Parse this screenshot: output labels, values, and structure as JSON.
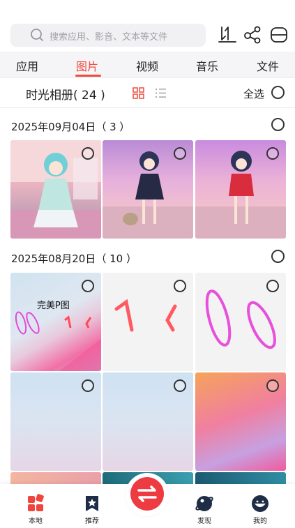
{
  "search": {
    "placeholder": "搜索应用、影音、文本等文件",
    "icon": "search-icon"
  },
  "toolbar": {
    "icons": [
      "sort-icon",
      "share-icon",
      "menu-icon"
    ]
  },
  "tabs": [
    {
      "label": "应用",
      "active": false
    },
    {
      "label": "图片",
      "active": true
    },
    {
      "label": "视频",
      "active": false
    },
    {
      "label": "音乐",
      "active": false
    },
    {
      "label": "文件",
      "active": false
    }
  ],
  "album": {
    "title": "时光相册( 24 )",
    "select_all": "全选"
  },
  "groups": [
    {
      "date": "2025年09月04日（ 3 ）"
    },
    {
      "date": "2025年08月20日（ 10 ）"
    }
  ],
  "thumbs": {
    "caption": "完美P图"
  },
  "bottom_nav": {
    "items": [
      {
        "label": "本地",
        "icon": "local-icon"
      },
      {
        "label": "推荐",
        "icon": "recommend-icon"
      },
      {
        "label": "发现",
        "icon": "discover-icon"
      },
      {
        "label": "我的",
        "icon": "profile-icon"
      }
    ],
    "center": {
      "icon": "transfer-icon"
    }
  },
  "colors": {
    "accent": "#f04a3e",
    "center_button": "#ee3a41"
  }
}
